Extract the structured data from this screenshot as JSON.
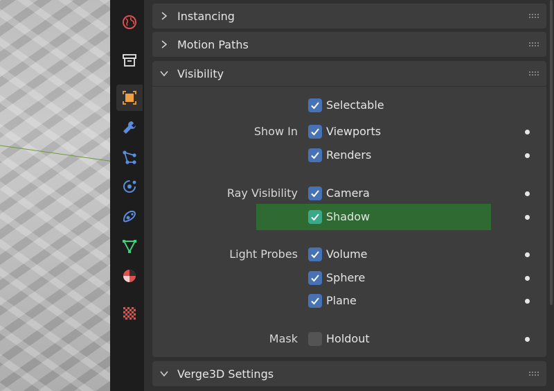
{
  "tabs": [
    {
      "name": "world-tab",
      "icon": "world-icon",
      "color": "#e0504f"
    },
    {
      "name": "collection-tab",
      "icon": "collection-box-icon",
      "color": "#e6e6e6"
    },
    {
      "name": "object-tab",
      "icon": "object-icon",
      "color": "#f0a040",
      "active": true
    },
    {
      "name": "modifier-tab",
      "icon": "wrench-icon",
      "color": "#5a8de0"
    },
    {
      "name": "particles-tab",
      "icon": "particles-icon",
      "color": "#5a8de0"
    },
    {
      "name": "physics-tab",
      "icon": "physics-icon",
      "color": "#5a8de0"
    },
    {
      "name": "constraints-tab",
      "icon": "constraint-icon",
      "color": "#5a8de0"
    },
    {
      "name": "data-tab",
      "icon": "mesh-data-icon",
      "color": "#3fd07a"
    },
    {
      "name": "material-tab",
      "icon": "material-icon",
      "color": "#e0504f"
    },
    {
      "name": "texture-tab",
      "icon": "texture-checker-icon",
      "color": "#e0504f"
    }
  ],
  "sections": {
    "instancing": {
      "title": "Instancing",
      "expanded": false
    },
    "motion_paths": {
      "title": "Motion Paths",
      "expanded": false
    },
    "visibility": {
      "title": "Visibility",
      "expanded": true
    },
    "verge3d": {
      "title": "Verge3D Settings",
      "expanded": true
    }
  },
  "visibility": {
    "selectable": {
      "label": "",
      "option": "Selectable",
      "checked": true
    },
    "show_in_label": "Show In",
    "viewports": {
      "option": "Viewports",
      "checked": true
    },
    "renders": {
      "option": "Renders",
      "checked": true
    },
    "ray_visibility_label": "Ray Visibility",
    "camera": {
      "option": "Camera",
      "checked": true
    },
    "shadow": {
      "option": "Shadow",
      "checked": true,
      "highlighted": true
    },
    "light_probes_label": "Light Probes",
    "volume": {
      "option": "Volume",
      "checked": true
    },
    "sphere": {
      "option": "Sphere",
      "checked": true
    },
    "plane": {
      "option": "Plane",
      "checked": true
    },
    "mask_label": "Mask",
    "holdout": {
      "option": "Holdout",
      "checked": false
    }
  },
  "colors": {
    "accent_checkbox": "#4772b3",
    "highlight_row": "#2e6a31",
    "highlight_checkbox": "#3aa98a"
  }
}
